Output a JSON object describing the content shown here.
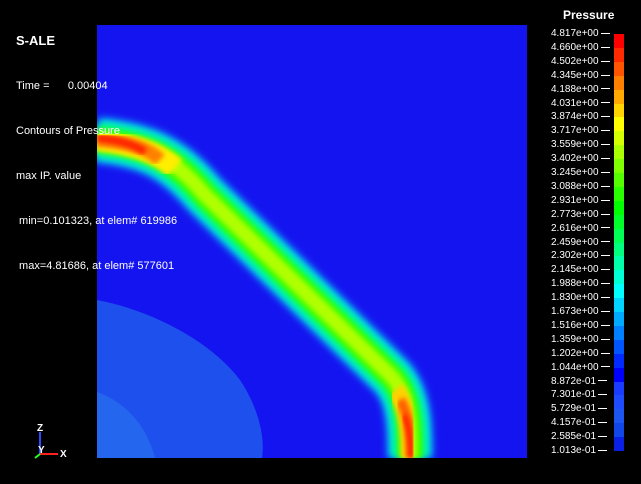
{
  "app": {
    "name": "S-ALE"
  },
  "hud": {
    "time_label": "Time =",
    "time_value": "0.00404",
    "contour_title": "Contours of Pressure",
    "value_type": "max IP. value",
    "min_line": " min=0.101323, at elem# 619986",
    "max_line": " max=4.81686, at elem# 577601"
  },
  "legend": {
    "title": "Pressure",
    "labels": [
      "4.817e+00",
      "4.660e+00",
      "4.502e+00",
      "4.345e+00",
      "4.188e+00",
      "4.031e+00",
      "3.874e+00",
      "3.717e+00",
      "3.559e+00",
      "3.402e+00",
      "3.245e+00",
      "3.088e+00",
      "2.931e+00",
      "2.773e+00",
      "2.616e+00",
      "2.459e+00",
      "2.302e+00",
      "2.145e+00",
      "1.988e+00",
      "1.830e+00",
      "1.673e+00",
      "1.516e+00",
      "1.359e+00",
      "1.202e+00",
      "1.044e+00",
      "8.872e-01",
      "7.301e-01",
      "5.729e-01",
      "4.157e-01",
      "2.585e-01",
      "1.013e-01"
    ],
    "colors": [
      "#ff0000",
      "#ff2a00",
      "#ff5500",
      "#ff7f00",
      "#ffaa00",
      "#ffd400",
      "#ffff00",
      "#d4ff00",
      "#aaff00",
      "#7fff00",
      "#55ff00",
      "#2aff00",
      "#00ff00",
      "#00ff2a",
      "#00ff55",
      "#00ff7f",
      "#00ffaa",
      "#00ffd4",
      "#00ffff",
      "#00d4ff",
      "#00aaff",
      "#007fff",
      "#0055ff",
      "#002aff",
      "#0000ff",
      "#1a3cff",
      "#1f4bff",
      "#1c55f0",
      "#1146e8",
      "#0a20e4"
    ]
  },
  "axes": {
    "z": "Z",
    "y": "Y",
    "x": "X"
  },
  "colors": {
    "background_field": "#1414f0",
    "low_region": "#1e5af0",
    "lower_region": "#2870f0"
  }
}
